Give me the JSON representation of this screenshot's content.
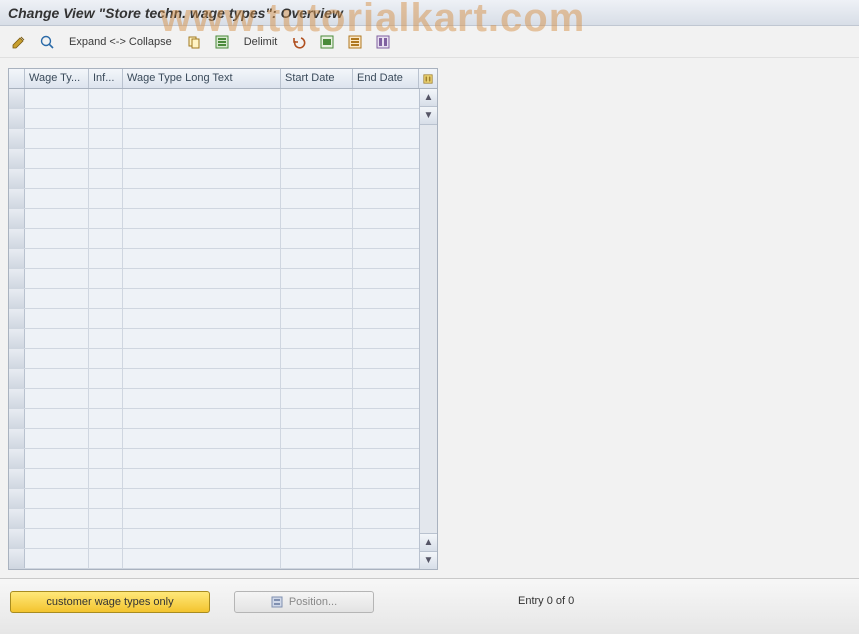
{
  "title": "Change View \"Store techn. wage types\": Overview",
  "watermark": "www.tutorialkart.com",
  "toolbar": {
    "expand_collapse": "Expand <-> Collapse",
    "delimit": "Delimit"
  },
  "grid": {
    "columns": {
      "wage_type": "Wage Ty...",
      "infotype": "Inf...",
      "long_text": "Wage Type Long Text",
      "start_date": "Start Date",
      "end_date": "End Date"
    },
    "row_count": 24
  },
  "footer": {
    "customer_btn": "customer wage types only",
    "position_btn": "Position...",
    "entry_text": "Entry 0 of 0"
  }
}
